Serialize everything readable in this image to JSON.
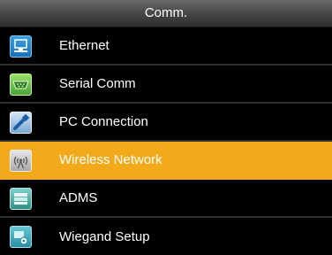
{
  "header": {
    "title": "Comm."
  },
  "menu": {
    "items": [
      {
        "label": "Ethernet",
        "icon": "ethernet-icon"
      },
      {
        "label": "Serial Comm",
        "icon": "serial-port-icon"
      },
      {
        "label": "PC Connection",
        "icon": "pc-connection-icon"
      },
      {
        "label": "Wireless Network",
        "icon": "wireless-antenna-icon",
        "selected": true
      },
      {
        "label": "ADMS",
        "icon": "adms-server-icon"
      },
      {
        "label": "Wiegand Setup",
        "icon": "wiegand-gear-icon"
      }
    ]
  },
  "colors": {
    "background": "#000000",
    "selected": "#f2aa1a",
    "text": "#ffffff",
    "divider": "#2f2f2f"
  }
}
